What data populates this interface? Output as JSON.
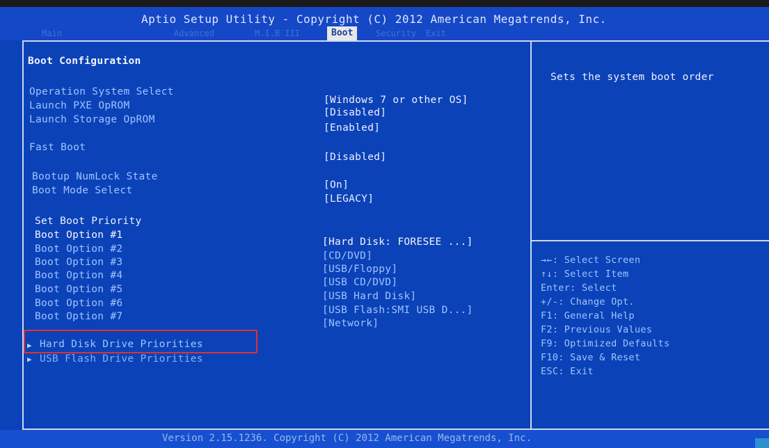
{
  "header": {
    "title": "Aptio Setup Utility - Copyright (C) 2012 American Megatrends, Inc.",
    "tabs": [
      {
        "label": "Main"
      },
      {
        "label": "Advanced"
      },
      {
        "label": "M.I.B III"
      },
      {
        "label": "Boot"
      },
      {
        "label": "Security"
      },
      {
        "label": "Exit"
      }
    ]
  },
  "section_title": "Boot Configuration",
  "settings": {
    "os_select": {
      "label": "Operation System Select",
      "value": "[Windows 7 or other OS]"
    },
    "pxe": {
      "label": "Launch PXE OpROM",
      "value": "[Disabled]"
    },
    "storage": {
      "label": "Launch Storage OpROM",
      "value": "[Enabled]"
    },
    "fast_boot": {
      "label": "Fast Boot",
      "value": "[Disabled]"
    },
    "numlock": {
      "label": "Bootup NumLock State",
      "value": "[On]"
    },
    "boot_mode": {
      "label": "Boot Mode Select",
      "value": "[LEGACY]"
    }
  },
  "priority_title": "Set Boot Priority",
  "boot_options": [
    {
      "label": "Boot Option #1",
      "value": "[Hard Disk: FORESEE ...]"
    },
    {
      "label": "Boot Option #2",
      "value": "[CD/DVD]"
    },
    {
      "label": "Boot Option #3",
      "value": "[USB/Floppy]"
    },
    {
      "label": "Boot Option #4",
      "value": "[USB CD/DVD]"
    },
    {
      "label": "Boot Option #5",
      "value": "[USB Hard Disk]"
    },
    {
      "label": "Boot Option #6",
      "value": "[USB Flash:SMI USB D...]"
    },
    {
      "label": "Boot Option #7",
      "value": "[Network]"
    }
  ],
  "submenus": [
    {
      "label": "Hard Disk Drive Priorities"
    },
    {
      "label": "USB Flash Drive Priorities"
    }
  ],
  "help_text": "Sets the system boot order",
  "key_help": [
    "→←: Select Screen",
    "↑↓: Select Item",
    "Enter: Select",
    "+/-: Change Opt.",
    "F1: General Help",
    "F2: Previous Values",
    "F9: Optimized Defaults",
    "F10: Save & Reset",
    "ESC: Exit"
  ],
  "footer": {
    "version": "Version 2.15.1236. Copyright (C) 2012 American Megatrends, Inc."
  },
  "colors": {
    "background": "#0b42b8",
    "highlight_box": "#e23030"
  }
}
